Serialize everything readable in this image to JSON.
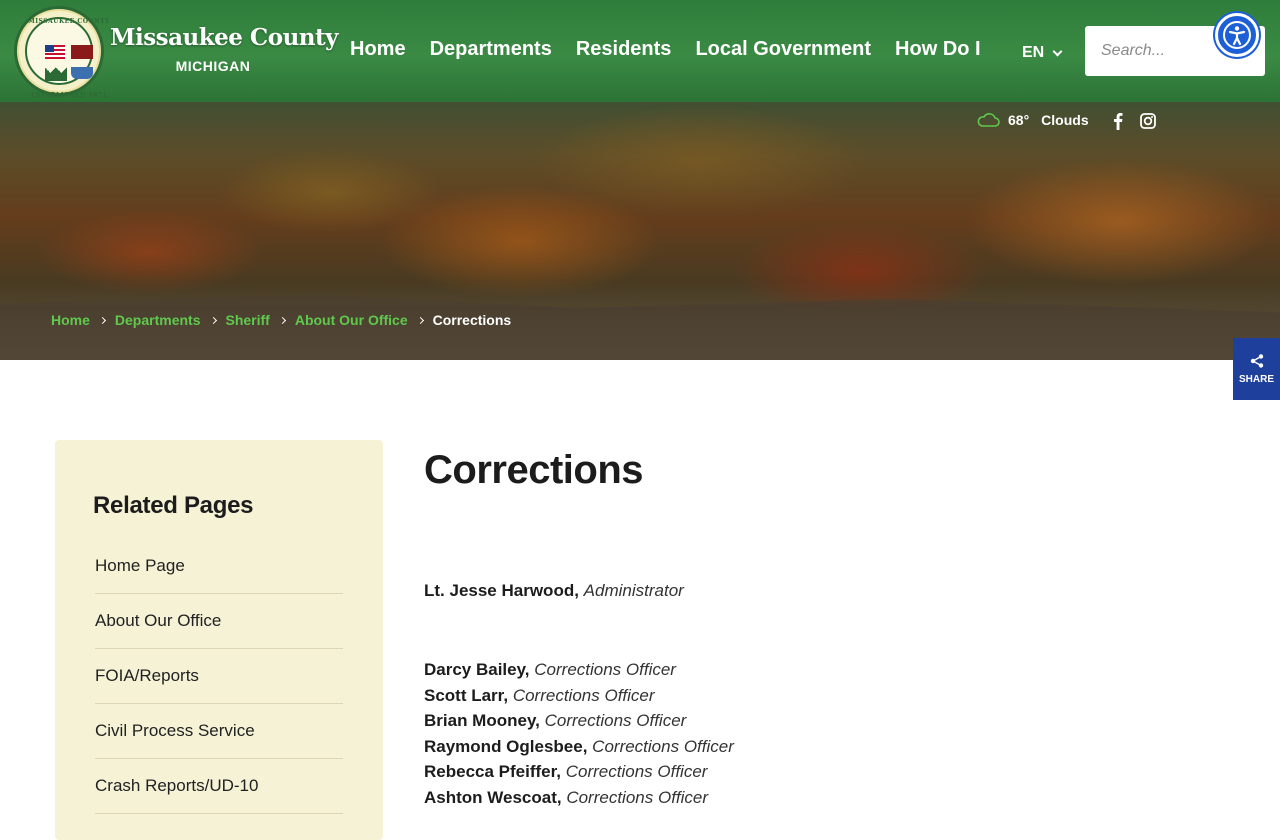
{
  "site": {
    "name": "Missaukee County",
    "state": "MICHIGAN",
    "seal_top": "MISSAUKEE COUNTY",
    "seal_bottom": "ESTABLISHED 1871"
  },
  "nav": {
    "items": [
      "Home",
      "Departments",
      "Residents",
      "Local Government",
      "How Do I"
    ],
    "language": "EN"
  },
  "search": {
    "placeholder": "Search..."
  },
  "weather": {
    "temp": "68°",
    "condition": "Clouds"
  },
  "breadcrumb": [
    "Home",
    "Departments",
    "Sheriff",
    "About Our Office",
    "Corrections"
  ],
  "share": {
    "label": "SHARE"
  },
  "sidebar": {
    "title": "Related Pages",
    "items": [
      "Home Page",
      "About Our Office",
      "FOIA/Reports",
      "Civil Process Service",
      "Crash Reports/UD-10"
    ]
  },
  "main": {
    "title": "Corrections",
    "admin": {
      "name": "Lt. Jesse Harwood,",
      "role": "Administrator"
    },
    "staff": [
      {
        "name": "Darcy Bailey,",
        "role": "Corrections Officer"
      },
      {
        "name": "Scott Larr,",
        "role": "Corrections Officer"
      },
      {
        "name": "Brian Mooney,",
        "role": "Corrections Officer"
      },
      {
        "name": "Raymond Oglesbee,",
        "role": "Corrections Officer"
      },
      {
        "name": "Rebecca Pfeiffer,",
        "role": "Corrections Officer"
      },
      {
        "name": "Ashton Wescoat,",
        "role": "Corrections Officer"
      }
    ]
  },
  "colors": {
    "header_green": "#2f7d3a",
    "breadcrumb_link": "#5fc94e",
    "share_blue": "#1f3f9c",
    "accessibility_blue": "#1d5fd6",
    "sidebar_bg": "#f5f2d6"
  }
}
